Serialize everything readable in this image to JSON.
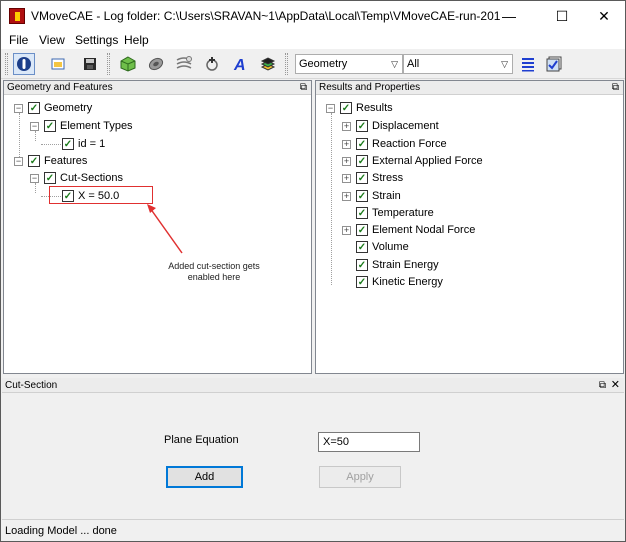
{
  "window": {
    "title": "VMoveCAE - Log folder: C:\\Users\\SRAVAN~1\\AppData\\Local\\Temp\\VMoveCAE-run-2019-10-21...",
    "minimize": "—",
    "maximize": "☐",
    "close": "✕"
  },
  "menu": [
    "File",
    "View",
    "Settings",
    "Help"
  ],
  "toolbar": {
    "combo1": "Geometry",
    "combo2": "All",
    "icons": [
      "info-icon",
      "open-icon",
      "save-icon",
      "cube-icon",
      "disc-icon",
      "lines-icon",
      "add-node-icon",
      "text-icon",
      "layers-icon",
      "list-icon",
      "checkbox-icon"
    ]
  },
  "left_panel": {
    "header": "Geometry and Features",
    "items": [
      {
        "label": "Geometry",
        "level": 0
      },
      {
        "label": "Element Types",
        "level": 1
      },
      {
        "label": "id = 1",
        "level": 2
      },
      {
        "label": "Features",
        "level": 0
      },
      {
        "label": "Cut-Sections",
        "level": 1
      },
      {
        "label": "X = 50.0",
        "level": 2
      }
    ],
    "annotation": "Added cut-section gets\nenabled here"
  },
  "right_panel": {
    "header": "Results and Properties",
    "root": "Results",
    "items": [
      {
        "label": "Displacement",
        "expandable": true
      },
      {
        "label": "Reaction Force",
        "expandable": true
      },
      {
        "label": "External Applied Force",
        "expandable": true
      },
      {
        "label": "Stress",
        "expandable": true
      },
      {
        "label": "Strain",
        "expandable": true
      },
      {
        "label": "Temperature",
        "expandable": false
      },
      {
        "label": "Element Nodal Force",
        "expandable": true
      },
      {
        "label": "Volume",
        "expandable": false
      },
      {
        "label": "Strain Energy",
        "expandable": false
      },
      {
        "label": "Kinetic Energy",
        "expandable": false
      }
    ]
  },
  "cut_section": {
    "header": "Cut-Section",
    "plane_label": "Plane Equation",
    "plane_value": "X=50",
    "add_label": "Add",
    "apply_label": "Apply"
  },
  "status": "Loading Model ... done"
}
